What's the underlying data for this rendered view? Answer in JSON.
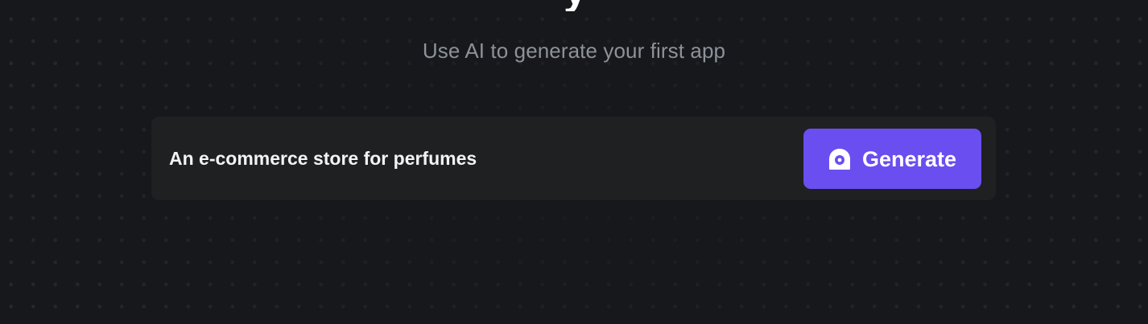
{
  "hero": {
    "title_fragment": "y",
    "subtitle": "Use AI to generate your first app"
  },
  "prompt": {
    "value": "An e-commerce store for perfumes",
    "generate_label": "Generate",
    "generate_icon": "ai-generate-icon"
  },
  "colors": {
    "background": "#16181b",
    "prompt_box": "#1f2022",
    "accent": "#6a4ef0",
    "subtitle": "#8d9199"
  }
}
